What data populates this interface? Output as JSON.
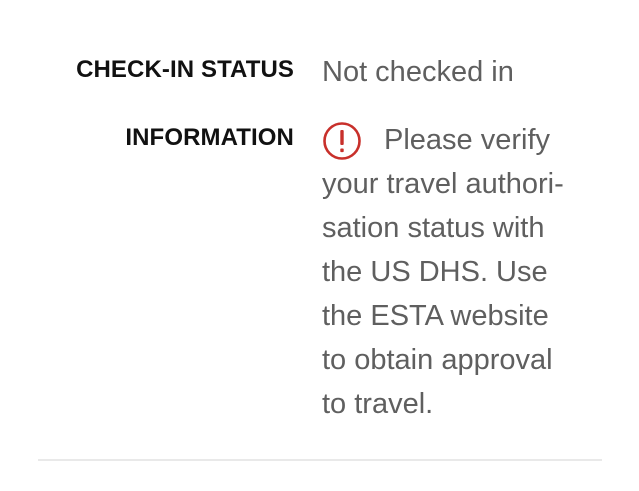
{
  "details": {
    "checkin": {
      "label": "CHECK-IN STATUS",
      "value": "Not checked in"
    },
    "information": {
      "label": "INFORMATION",
      "icon": "alert-circle-icon",
      "icon_color": "#c8302b",
      "lines": [
        "Please verify",
        "your travel authori-",
        "sation status with",
        "the US DHS. Use",
        "the ESTA website",
        "to obtain approval",
        "to travel."
      ]
    }
  }
}
